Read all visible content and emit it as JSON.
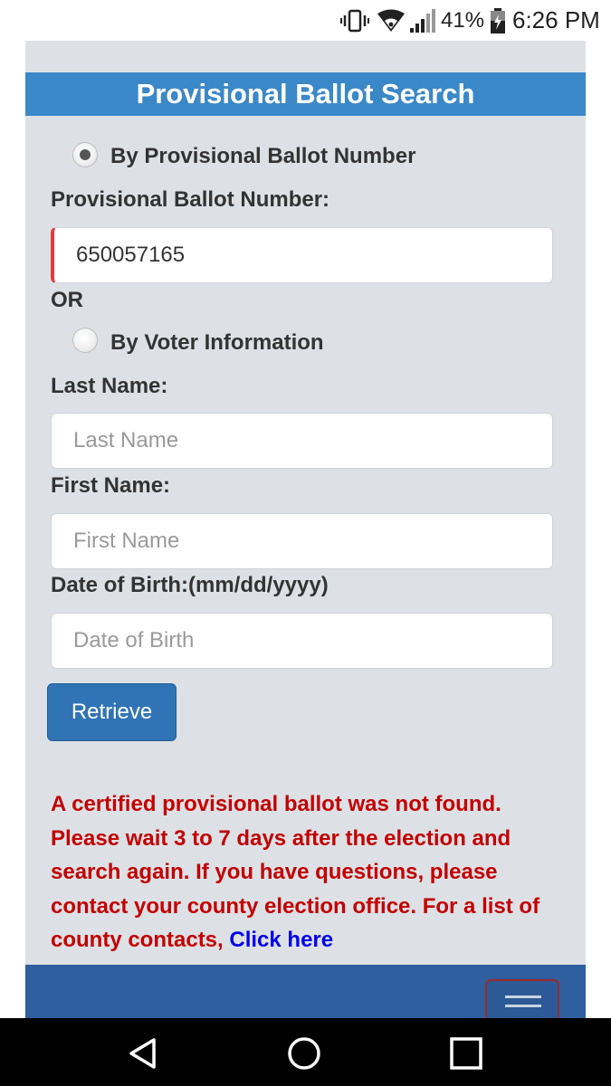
{
  "status_bar": {
    "battery_percent": "41%",
    "time": "6:26 PM",
    "icons": [
      "vibrate-icon",
      "wifi-icon",
      "signal-icon",
      "battery-icon"
    ]
  },
  "page": {
    "title": "Provisional Ballot Search",
    "option_ballot_label": "By Provisional Ballot Number",
    "ballot_number_label": "Provisional Ballot Number:",
    "ballot_number_value": "650057165",
    "or_text": "OR",
    "option_voter_label": "By Voter Information",
    "last_name_label": "Last Name:",
    "last_name_placeholder": "Last Name",
    "first_name_label": "First Name:",
    "first_name_placeholder": "First Name",
    "dob_label": "Date of Birth:(mm/dd/yyyy)",
    "dob_placeholder": "Date of Birth",
    "retrieve_label": "Retrieve",
    "message_text": "A certified provisional ballot was not found. Please wait 3 to 7 days after the election and search again. If you have questions, please contact your county election office. For a list of county contacts, ",
    "message_link": "Click here"
  },
  "colors": {
    "title_bar": "#3a88c8",
    "panel_bg": "#dde1e6",
    "button": "#3174b5",
    "error_text": "#c40000",
    "link": "#0000ee",
    "footer": "#2f5f9e"
  },
  "nav_bar": {
    "icons": [
      "back-icon",
      "home-icon",
      "recents-icon"
    ]
  }
}
